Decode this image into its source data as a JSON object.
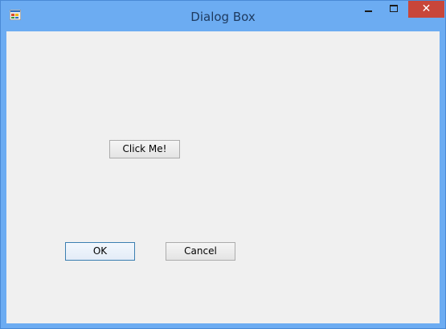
{
  "window": {
    "title": "Dialog Box",
    "icon": "app-window-icon",
    "controls": {
      "minimize_icon": "minimize-icon",
      "maximize_icon": "maximize-icon",
      "close_glyph": "✕",
      "close_color": "#c8463a"
    },
    "frame_color": "#6cacf2",
    "client_color": "#f0f0f0"
  },
  "buttons": {
    "click_me_label": "Click Me!",
    "ok_label": "OK",
    "cancel_label": "Cancel"
  }
}
